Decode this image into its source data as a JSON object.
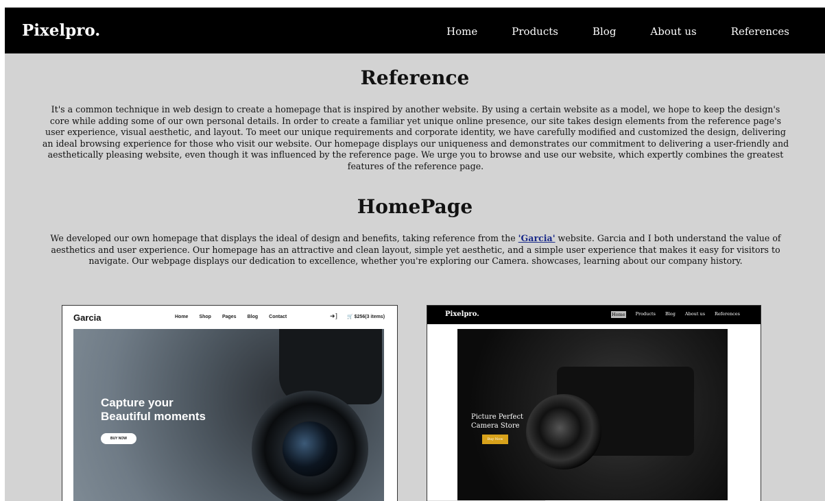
{
  "nav": {
    "brand": "Pixelpro.",
    "links": [
      "Home",
      "Products",
      "Blog",
      "About us",
      "References"
    ]
  },
  "reference": {
    "title": "Reference",
    "body": "It's a common technique in web design to create a homepage that is inspired by another website. By using a certain website as a model, we hope to keep the design's core while adding some of our own personal details. In order to create a familiar yet unique online presence, our site takes design elements from the reference page's user experience, visual aesthetic, and layout. To meet our unique requirements and corporate identity, we have carefully modified and customized the design, delivering an ideal browsing experience for those who visit our website. Our homepage displays our uniqueness and demonstrates our commitment to delivering a user-friendly and aesthetically pleasing website, even though it was influenced by the reference page. We urge you to browse and use our website, which expertly combines the greatest features of the reference page."
  },
  "homepage": {
    "title": "HomePage",
    "body_before": "We developed our own homepage that displays the ideal of design and benefits, taking reference from the ",
    "link_text": "'Garcia'",
    "body_after": " website. Garcia and I both understand the value of aesthetics and user experience. Our homepage has an attractive and clean layout, simple yet aesthetic, and a simple user experience that makes it easy for visitors to navigate. Our webpage displays our dedication to excellence, whether you're exploring our Camera. showcases, learning about our company history."
  },
  "garcia_shot": {
    "logo": "Garcia",
    "links": [
      "Home",
      "Shop",
      "Pages",
      "Blog",
      "Contact"
    ],
    "cart": "$256(3 items)",
    "hero_line1": "Capture your",
    "hero_line2": "Beautiful moments",
    "button": "BUY NOW"
  },
  "pixelpro_shot": {
    "logo": "Pixelpro.",
    "links": [
      "Home",
      "Products",
      "Blog",
      "About us",
      "References"
    ],
    "hero_line1": "Picture Perfect",
    "hero_line2": "Camera Store",
    "button": "Buy Now"
  }
}
